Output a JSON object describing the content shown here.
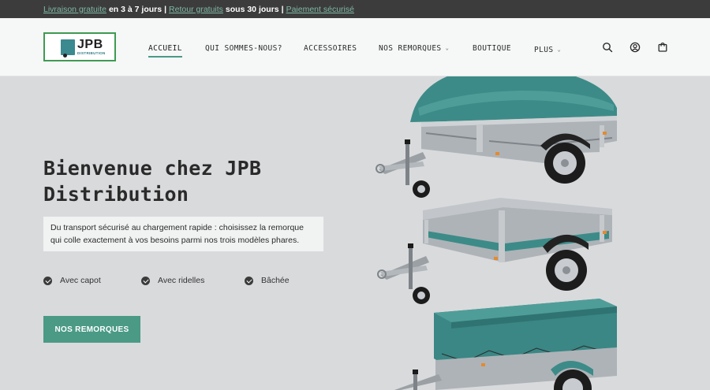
{
  "topbar": {
    "link1": "Livraison gratuite",
    "text1": "en 3 à 7 jours",
    "link2": "Retour gratuits",
    "text2": "sous 30 jours",
    "link3": "Paiement sécurisé",
    "separator": "|"
  },
  "logo": {
    "name": "JPB",
    "tagline": "DISTRIBUTION"
  },
  "nav": {
    "items": [
      {
        "label": "ACCUEIL",
        "active": true
      },
      {
        "label": "QUI SOMMES-NOUS?"
      },
      {
        "label": "ACCESSOIRES"
      },
      {
        "label": "NOS REMORQUES",
        "dropdown": true
      },
      {
        "label": "BOUTIQUE"
      },
      {
        "label": "PLUS",
        "dropdown": true
      }
    ],
    "icons": [
      "search-icon",
      "account-icon",
      "cart-icon"
    ]
  },
  "hero": {
    "title": "Bienvenue chez JPB Distribution",
    "description": "Du transport sécurisé au chargement rapide : choisissez la remorque qui colle exactement à vos besoins parmi nos trois modèles phares.",
    "features": [
      "Avec capot",
      "Avec ridelles",
      "Bâchée"
    ],
    "cta": "NOS REMORQUES"
  },
  "colors": {
    "accent": "#4a9a86",
    "topbar_bg": "#3c3c3c",
    "link": "#7fb7a5",
    "hero_bg": "#d9dadc",
    "logo_border": "#3f9a52",
    "trailer_teal": "#3d8b88"
  }
}
